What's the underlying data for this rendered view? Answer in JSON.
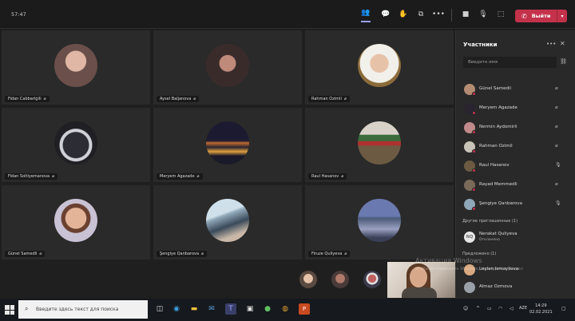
{
  "topbar": {
    "timer": "57:47",
    "leave_label": "Выйти"
  },
  "tiles": [
    {
      "name": "Fidan Cabbarlgili",
      "avatar_color": "#6b4f4a"
    },
    {
      "name": "Aysel Baljanova",
      "avatar_color": "#3a2b2b"
    },
    {
      "name": "Rahman Ozimli",
      "avatar_color": "#c9c4b8"
    },
    {
      "name": "Fidan Soltiyemanova",
      "avatar_color": "#1f1f24"
    },
    {
      "name": "Meryem Agazade",
      "avatar_color": "#2a2430"
    },
    {
      "name": "Raul Hasanov",
      "avatar_color": "#6c5a43"
    },
    {
      "name": "Günel Samedli",
      "avatar_color": "#b48b73"
    },
    {
      "name": "Şengiye Qanbarova",
      "avatar_color": "#8fa7b8"
    },
    {
      "name": "Firuze Quliyeva",
      "avatar_color": "#4a5a78"
    }
  ],
  "panel": {
    "title": "Участники",
    "search_placeholder": "Введите имя",
    "participants": [
      {
        "name": "Günel Samedli",
        "color": "#b48b73"
      },
      {
        "name": "Meryem Agazade",
        "color": "#2a2430"
      },
      {
        "name": "Nermin Aydomirli",
        "color": "#c08a8a"
      },
      {
        "name": "Rahman Ozimli",
        "color": "#c9c4b8"
      },
      {
        "name": "Raul Hasanov",
        "color": "#6c5a43"
      },
      {
        "name": "Rayad Memmedli",
        "color": "#7a6a5a"
      },
      {
        "name": "Şengiye Qanbarova",
        "color": "#8fa7b8"
      }
    ],
    "other_apps_label": "Другие приглашенные (1)",
    "pending": {
      "initials": "NQ",
      "name": "Nerakat Quliyeva",
      "status": "Отклонено"
    },
    "invited_label": "Предложено (1)",
    "invited": [
      {
        "name": "Leylan Ismayilova",
        "color": "#d9a87f"
      },
      {
        "name": "Almaz Ozmova",
        "color": "#9aa0a8"
      }
    ]
  },
  "watermark": {
    "title": "Активация Windows",
    "subtitle": "Чтобы активировать Windows, перейдите в раздел"
  },
  "taskbar": {
    "search_placeholder": "Введите здесь текст для поиска",
    "lang": "AZE",
    "time": "14:29",
    "date": "02.02.2021"
  }
}
